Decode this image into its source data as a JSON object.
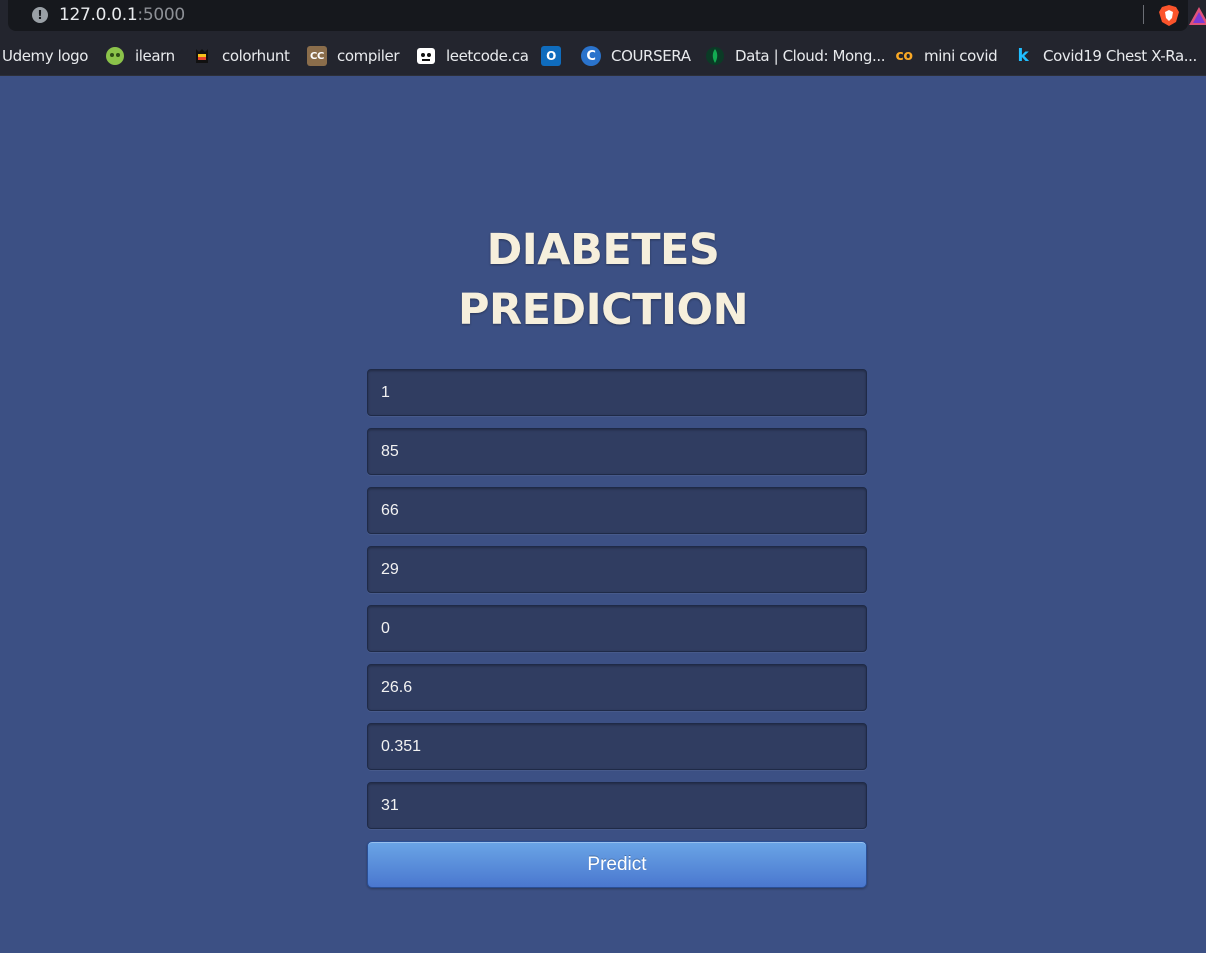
{
  "browser": {
    "url_host": "127.0.0.1",
    "url_port": ":5000"
  },
  "bookmarks": [
    {
      "label": "Udemy logo",
      "icon": "none"
    },
    {
      "label": "ilearn",
      "icon": "ilearn-icon"
    },
    {
      "label": "colorhunt",
      "icon": "colorhunt-icon"
    },
    {
      "label": "compiler",
      "icon": "compiler-icon",
      "glyph": "CC"
    },
    {
      "label": "leetcode.ca",
      "icon": "leetcode-icon"
    },
    {
      "label": "",
      "icon": "outlook-icon",
      "glyph": "O"
    },
    {
      "label": "COURSERA",
      "icon": "coursera-icon",
      "glyph": "C"
    },
    {
      "label": "Data | Cloud: Mong...",
      "icon": "mongodb-icon"
    },
    {
      "label": "mini covid",
      "icon": "mini-covid-icon",
      "glyph": "co"
    },
    {
      "label": "Covid19 Chest X-Ra...",
      "icon": "kaggle-icon",
      "glyph": "k"
    }
  ],
  "page": {
    "title_line1": "DIABETES",
    "title_line2": "PREDICTION",
    "fields": [
      "1",
      "85",
      "66",
      "29",
      "0",
      "26.6",
      "0.351",
      "31"
    ],
    "predict_label": "Predict"
  },
  "colors": {
    "background": "#3c5084",
    "title": "#f6efdc",
    "field_bg": "#303d61",
    "button_top": "#6aa5e6",
    "button_bottom": "#4a77cf"
  }
}
